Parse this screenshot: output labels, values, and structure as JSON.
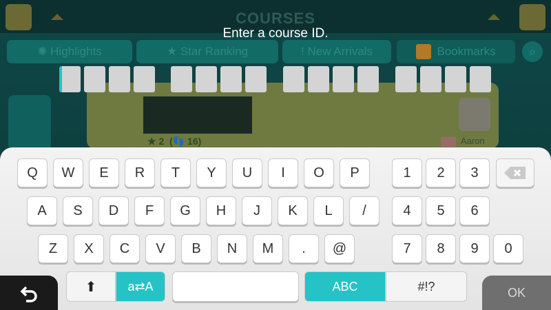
{
  "header": {
    "title": "COURSES",
    "prompt": "Enter a course ID."
  },
  "tabs": [
    {
      "label": "Highlights",
      "icon": "sparkle-icon"
    },
    {
      "label": "Star Ranking",
      "icon": "star-icon"
    },
    {
      "label": "New Arrivals",
      "icon": "exclamation-icon"
    },
    {
      "label": "Bookmarks",
      "icon": "bookmark-icon"
    }
  ],
  "course": {
    "stars": "2",
    "plays": "16",
    "maker": "Aaron"
  },
  "id_entry": {
    "groups": 4,
    "chars_per_group": 4,
    "active_index": 0
  },
  "keyboard": {
    "row1": [
      "Q",
      "W",
      "E",
      "R",
      "T",
      "Y",
      "U",
      "I",
      "O",
      "P"
    ],
    "row2": [
      "A",
      "S",
      "D",
      "F",
      "G",
      "H",
      "J",
      "K",
      "L",
      "/"
    ],
    "row3": [
      "Z",
      "X",
      "C",
      "V",
      "B",
      "N",
      "M",
      ".",
      "@"
    ],
    "num_row1": [
      "1",
      "2",
      "3"
    ],
    "num_row2": [
      "4",
      "5",
      "6"
    ],
    "num_row3": [
      "7",
      "8",
      "9",
      "0"
    ],
    "case_toggle": "a⇄A",
    "mode_abc": "ABC",
    "mode_symbols": "#!?",
    "ok": "OK"
  },
  "colors": {
    "accent": "#25c3c6",
    "ok_bg": "#6f6f6f",
    "return_bg": "#1a1a1a"
  }
}
